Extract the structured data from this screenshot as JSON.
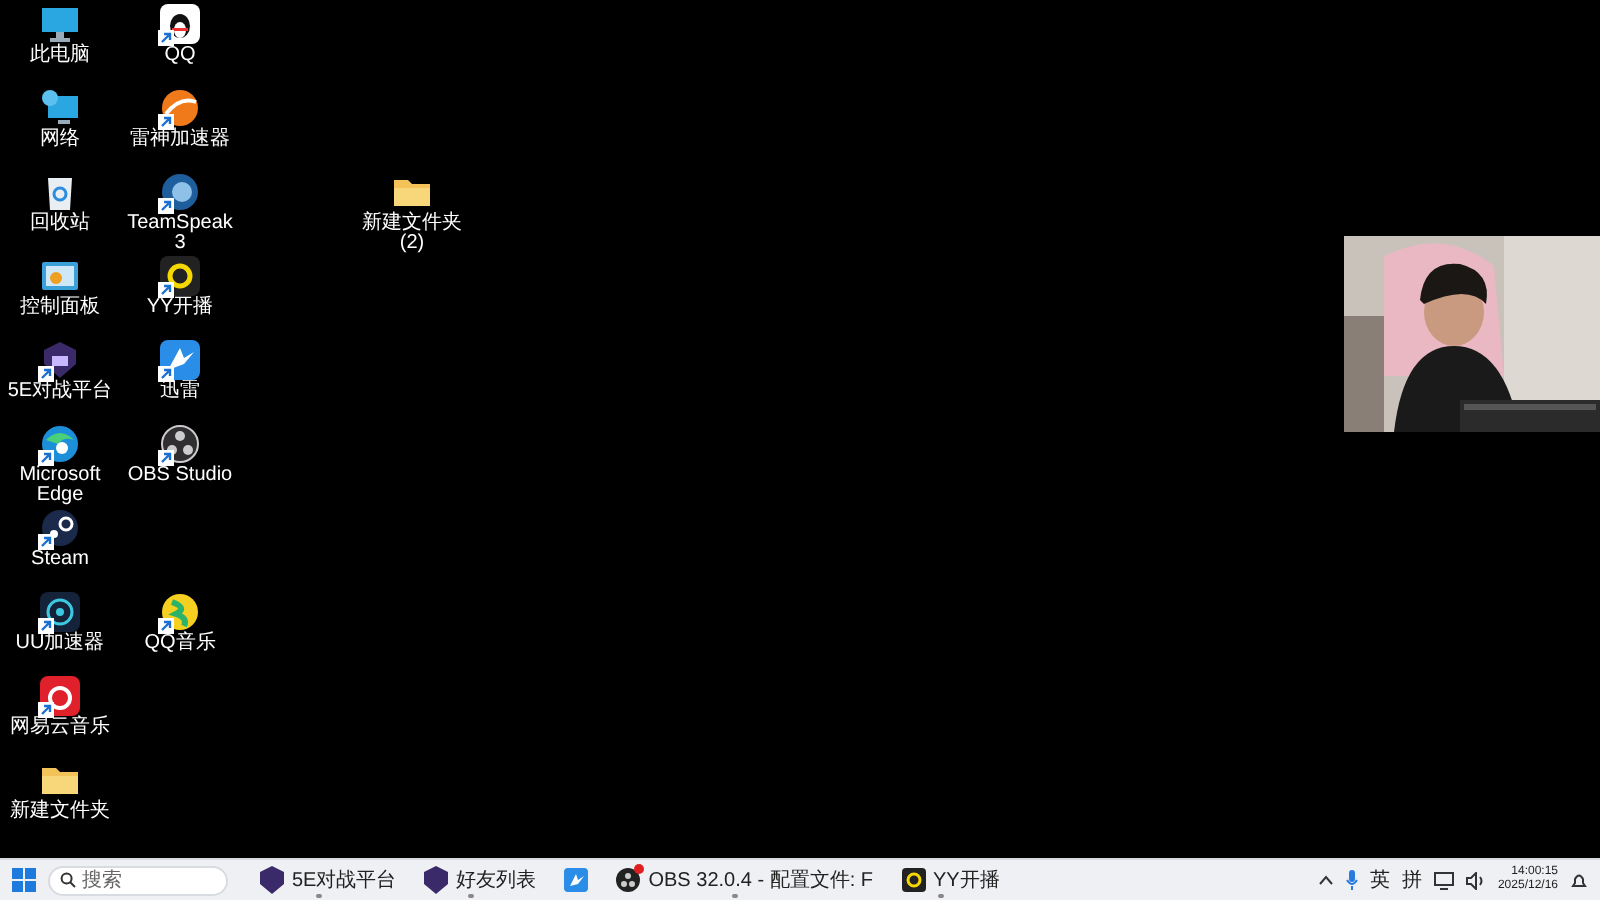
{
  "desktop": {
    "icon_rows": [
      {
        "icons": [
          {
            "label": "此电脑",
            "shortcut": false
          },
          {
            "label": "QQ",
            "shortcut": true
          }
        ]
      },
      {
        "icons": [
          {
            "label": "网络",
            "shortcut": false
          },
          {
            "label": "雷神加速器",
            "shortcut": true
          }
        ]
      },
      {
        "icons": [
          {
            "label": "回收站",
            "shortcut": false
          },
          {
            "label": "TeamSpeak 3",
            "shortcut": true
          }
        ]
      },
      {
        "icons": [
          {
            "label": "控制面板",
            "shortcut": false
          },
          {
            "label": "YY开播",
            "shortcut": true
          }
        ]
      },
      {
        "icons": [
          {
            "label": "5E对战平台",
            "shortcut": true
          },
          {
            "label": "迅雷",
            "shortcut": true
          }
        ]
      },
      {
        "icons": [
          {
            "label": "Microsoft Edge",
            "shortcut": true
          },
          {
            "label": "OBS Studio",
            "shortcut": true
          }
        ]
      },
      {
        "icons": [
          {
            "label": "Steam",
            "shortcut": true
          }
        ]
      },
      {
        "icons": [
          {
            "label": "UU加速器",
            "shortcut": true
          },
          {
            "label": "QQ音乐",
            "shortcut": true
          }
        ]
      },
      {
        "icons": [
          {
            "label": "网易云音乐",
            "shortcut": true
          }
        ]
      },
      {
        "icons": [
          {
            "label": "新建文件夹",
            "shortcut": false
          }
        ]
      }
    ],
    "loose_icon": {
      "label": "新建文件夹 (2)"
    }
  },
  "taskbar": {
    "search": {
      "placeholder": "搜索"
    },
    "apps": [
      {
        "label": "5E对战平台",
        "running": true,
        "alert": false
      },
      {
        "label": "好友列表",
        "running": true,
        "alert": false
      },
      {
        "running": false,
        "alert": false
      },
      {
        "label": "OBS 32.0.4 - 配置文件: F",
        "running": true,
        "alert": true
      },
      {
        "label": "YY开播",
        "running": true,
        "alert": false
      }
    ],
    "tray": {
      "input_language": "英",
      "input_mode": "拼",
      "time": "14:00:15",
      "date": "2025/12/16"
    }
  }
}
